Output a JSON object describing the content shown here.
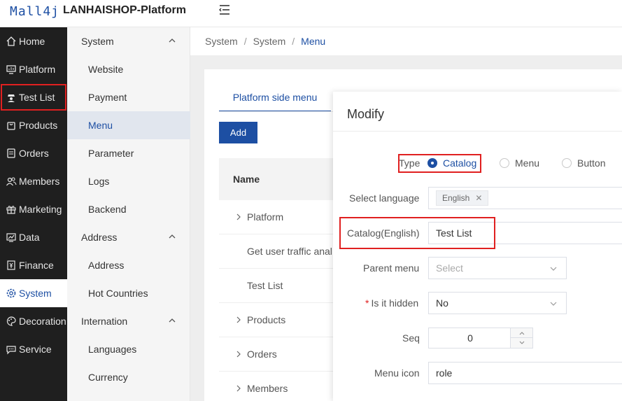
{
  "header": {
    "logo": "Mall4j",
    "title": "LANHAISHOP-Platform"
  },
  "sidebar": {
    "items": [
      {
        "label": "Home",
        "icon": "home-icon"
      },
      {
        "label": "Platform",
        "icon": "monitor-icon"
      },
      {
        "label": "Test List",
        "icon": "spy-icon"
      },
      {
        "label": "Products",
        "icon": "bag-icon"
      },
      {
        "label": "Orders",
        "icon": "document-icon"
      },
      {
        "label": "Members",
        "icon": "users-icon"
      },
      {
        "label": "Marketing",
        "icon": "gift-icon"
      },
      {
        "label": "Data",
        "icon": "chart-icon"
      },
      {
        "label": "Finance",
        "icon": "finance-icon"
      },
      {
        "label": "System",
        "icon": "gear-icon"
      },
      {
        "label": "Decoration",
        "icon": "palette-icon"
      },
      {
        "label": "Service",
        "icon": "chat-icon"
      }
    ],
    "active": "System"
  },
  "submenu": {
    "groups": [
      {
        "label": "System",
        "items": [
          "Website",
          "Payment",
          "Menu",
          "Parameter",
          "Logs",
          "Backend"
        ]
      },
      {
        "label": "Address",
        "items": [
          "Address",
          "Hot Countries"
        ]
      },
      {
        "label": "Internation",
        "items": [
          "Languages",
          "Currency"
        ]
      }
    ],
    "active": "Menu"
  },
  "breadcrumb": [
    "System",
    "System",
    "Menu"
  ],
  "content": {
    "tab": "Platform side menu",
    "add_label": "Add",
    "column_name": "Name",
    "rows": [
      {
        "label": "Platform",
        "expandable": true
      },
      {
        "label": "Get user traffic anal",
        "expandable": false
      },
      {
        "label": "Test List",
        "expandable": false
      },
      {
        "label": "Products",
        "expandable": true
      },
      {
        "label": "Orders",
        "expandable": true
      },
      {
        "label": "Members",
        "expandable": true
      }
    ]
  },
  "modal": {
    "title": "Modify",
    "type_label": "Type",
    "type_options": [
      "Catalog",
      "Menu",
      "Button"
    ],
    "type_selected": "Catalog",
    "language_label": "Select language",
    "language_tag": "English",
    "catalog_label": "Catalog(English)",
    "catalog_value": "Test List",
    "parent_label": "Parent menu",
    "parent_placeholder": "Select",
    "hidden_required": "*",
    "hidden_label": "Is it hidden",
    "hidden_value": "No",
    "seq_label": "Seq",
    "seq_value": "0",
    "icon_label": "Menu icon",
    "icon_value": "role"
  },
  "colors": {
    "primary": "#1d4fa3",
    "sidebar_bg": "#1f1f1f",
    "highlight": "#e02020"
  }
}
